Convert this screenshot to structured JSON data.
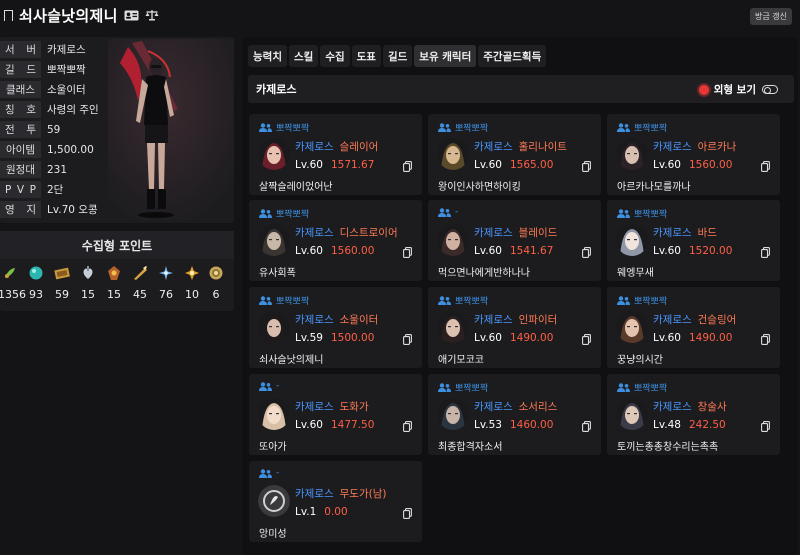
{
  "header": {
    "name": "쇠사슬낫의제니",
    "refresh_label": "방금 갱신"
  },
  "profile": {
    "rows": [
      {
        "label_chars": [
          "서",
          "버"
        ],
        "value": "카제로스"
      },
      {
        "label_chars": [
          "길",
          "드"
        ],
        "value": "뽀짝뽀짝"
      },
      {
        "label_chars": [
          "클래스"
        ],
        "value": "소울이터"
      },
      {
        "label_chars": [
          "칭",
          "호"
        ],
        "value": "사령의 주인"
      },
      {
        "label_chars": [
          "전",
          "투"
        ],
        "value": "59"
      },
      {
        "label_chars": [
          "아이템"
        ],
        "value": "1,500.00"
      },
      {
        "label_chars": [
          "원정대"
        ],
        "value": "231"
      },
      {
        "label_chars": [
          "P",
          "V",
          "P"
        ],
        "value": "2단"
      },
      {
        "label_chars": [
          "영",
          "지"
        ],
        "value": "Lv.70 오콩"
      }
    ]
  },
  "collection": {
    "title": "수집형 포인트",
    "items": [
      {
        "icon": "mokoko-seed-icon",
        "value": "1356"
      },
      {
        "icon": "island-heart-icon",
        "value": "93"
      },
      {
        "icon": "masterpiece-icon",
        "value": "59"
      },
      {
        "icon": "giant-heart-icon",
        "value": "15"
      },
      {
        "icon": "ignea-token-icon",
        "value": "15"
      },
      {
        "icon": "adventure-book-icon",
        "value": "45"
      },
      {
        "icon": "sea-bounty-icon",
        "value": "76"
      },
      {
        "icon": "world-tree-leaf-icon",
        "value": "10"
      },
      {
        "icon": "orpheus-star-icon",
        "value": "6"
      }
    ]
  },
  "tabs": [
    "능력치",
    "스킬",
    "수집",
    "도표",
    "길드",
    "보유 캐릭터",
    "주간골드획득"
  ],
  "active_tab": "보유 캐릭터",
  "server_bar": {
    "server": "카제로스",
    "view_label": "외형 보기"
  },
  "characters": [
    {
      "guild": "뽀짝뽀짝",
      "server": "카제로스",
      "class": "슬레이어",
      "level": "Lv.60",
      "item_level": "1571.67",
      "name": "살짝슬레이었어난"
    },
    {
      "guild": "뽀짝뽀짝",
      "server": "카제로스",
      "class": "홀리나이트",
      "level": "Lv.60",
      "item_level": "1565.00",
      "name": "왕이인사하면하이킹"
    },
    {
      "guild": "뽀짝뽀짝",
      "server": "카제로스",
      "class": "아르카나",
      "level": "Lv.60",
      "item_level": "1560.00",
      "name": "아르카나모를까나"
    },
    {
      "guild": "뽀짝뽀짝",
      "server": "카제로스",
      "class": "디스트로이어",
      "level": "Lv.60",
      "item_level": "1560.00",
      "name": "유사회폭"
    },
    {
      "guild": "-",
      "server": "카제로스",
      "class": "블레이드",
      "level": "Lv.60",
      "item_level": "1541.67",
      "name": "먹으면나에게반하나나"
    },
    {
      "guild": "뽀짝뽀짝",
      "server": "카제로스",
      "class": "바드",
      "level": "Lv.60",
      "item_level": "1520.00",
      "name": "웨엥무새"
    },
    {
      "guild": "뽀짝뽀짝",
      "server": "카제로스",
      "class": "소울이터",
      "level": "Lv.59",
      "item_level": "1500.00",
      "name": "쇠사슬낫의제니"
    },
    {
      "guild": "뽀짝뽀짝",
      "server": "카제로스",
      "class": "인파이터",
      "level": "Lv.60",
      "item_level": "1490.00",
      "name": "애기모코코"
    },
    {
      "guild": "뽀짝뽀짝",
      "server": "카제로스",
      "class": "건슬링어",
      "level": "Lv.60",
      "item_level": "1490.00",
      "name": "꿍냥의시간"
    },
    {
      "guild": "-",
      "server": "카제로스",
      "class": "도화가",
      "level": "Lv.60",
      "item_level": "1477.50",
      "name": "또아가"
    },
    {
      "guild": "뽀짝뽀짝",
      "server": "카제로스",
      "class": "소서리스",
      "level": "Lv.53",
      "item_level": "1460.00",
      "name": "최종합격자소서"
    },
    {
      "guild": "뽀짝뽀짝",
      "server": "카제로스",
      "class": "창술사",
      "level": "Lv.48",
      "item_level": "242.50",
      "name": "토끼는총총창수리는촉촉"
    },
    {
      "guild": "-",
      "server": "카제로스",
      "class": "무도가(남)",
      "level": "Lv.1",
      "item_level": "0.00",
      "name": "앙미성"
    }
  ],
  "colors": {
    "accent_blue": "#4a97ff",
    "guild_blue": "#3d8fe0",
    "class_orange": "#ff7a55",
    "item_level_red": "#ff5f45"
  }
}
